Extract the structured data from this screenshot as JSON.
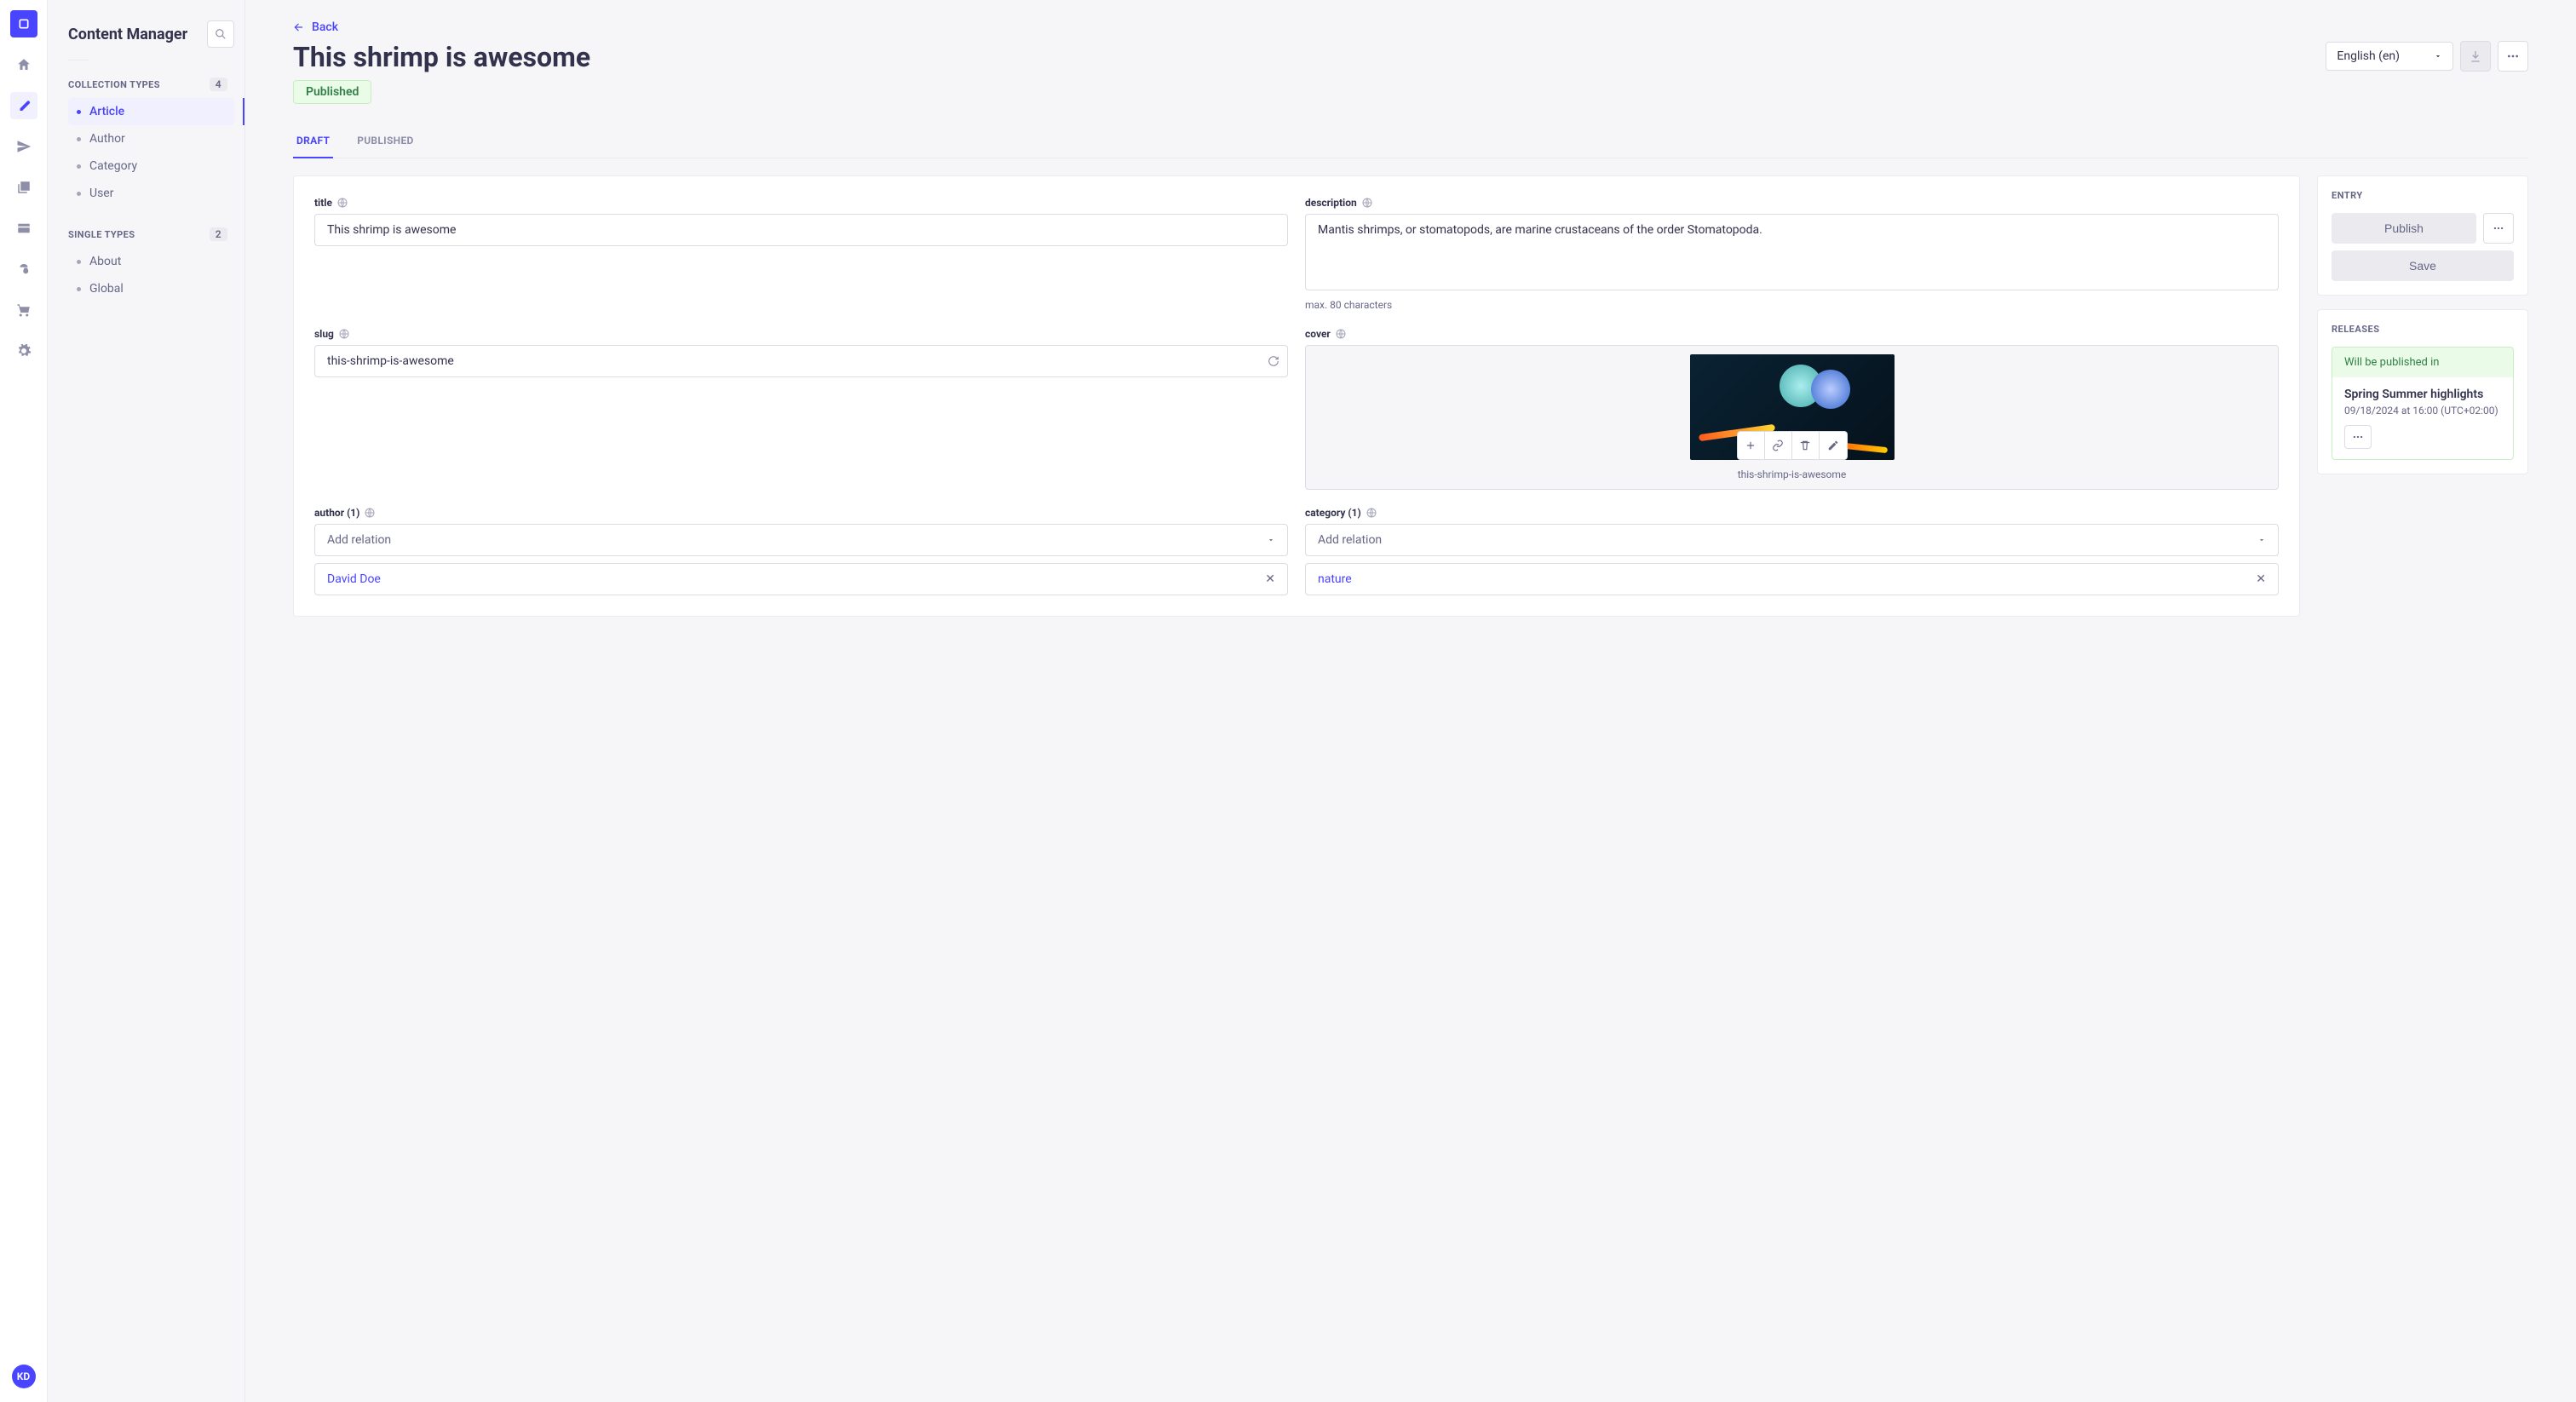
{
  "sidebar": {
    "title": "Content Manager",
    "collection_types_label": "COLLECTION TYPES",
    "collection_types_count": "4",
    "single_types_label": "SINGLE TYPES",
    "single_types_count": "2",
    "collection_items": [
      {
        "label": "Article",
        "active": true
      },
      {
        "label": "Author"
      },
      {
        "label": "Category"
      },
      {
        "label": "User"
      }
    ],
    "single_items": [
      {
        "label": "About"
      },
      {
        "label": "Global"
      }
    ],
    "user_initials": "KD"
  },
  "header": {
    "back_label": "Back",
    "title": "This shrimp is awesome",
    "status": "Published",
    "locale": "English (en)"
  },
  "tabs": [
    {
      "label": "DRAFT",
      "active": true
    },
    {
      "label": "PUBLISHED"
    }
  ],
  "fields": {
    "title": {
      "label": "title",
      "value": "This shrimp is awesome"
    },
    "description": {
      "label": "description",
      "value": "Mantis shrimps, or stomatopods, are marine crustaceans of the order Stomatopoda.",
      "help": "max. 80 characters"
    },
    "slug": {
      "label": "slug",
      "value": "this-shrimp-is-awesome"
    },
    "cover": {
      "label": "cover",
      "caption": "this-shrimp-is-awesome"
    },
    "author": {
      "label": "author (1)",
      "placeholder": "Add relation",
      "selected": "David Doe"
    },
    "category": {
      "label": "category (1)",
      "placeholder": "Add relation",
      "selected": "nature"
    }
  },
  "entry_panel": {
    "heading": "ENTRY",
    "publish_label": "Publish",
    "save_label": "Save"
  },
  "releases_panel": {
    "heading": "RELEASES",
    "banner": "Will be published in",
    "title": "Spring Summer highlights",
    "date": "09/18/2024 at 16:00 (UTC+02:00)"
  }
}
